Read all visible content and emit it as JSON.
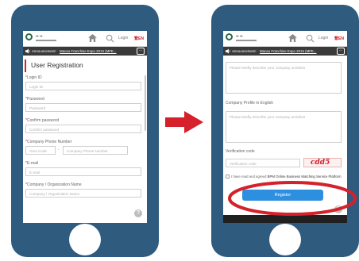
{
  "header": {
    "login_label": "Login",
    "lang_label": "繁EN"
  },
  "announcement": {
    "label": "Announcement:",
    "link_text": "Macao Franchise Expo 2016 (MFE...",
    "more_label": "···"
  },
  "left_screen": {
    "title": "User Registration",
    "fields": [
      {
        "label": "Login ID",
        "required": true,
        "placeholder": "Login ID"
      },
      {
        "label": "Password",
        "required": true,
        "placeholder": "Password"
      },
      {
        "label": "Confirm password",
        "required": true,
        "placeholder": "Confirm password"
      },
      {
        "label": "Company Phone Number",
        "required": true,
        "area_placeholder": "Area Code",
        "dash": "-",
        "phone_placeholder": "Company Phone Number"
      },
      {
        "label": "E-mail",
        "required": true,
        "placeholder": "E-mail"
      },
      {
        "label": "Company / Organization Name",
        "required": true,
        "placeholder": "Company / Organization Name"
      }
    ],
    "help_label": "?"
  },
  "right_screen": {
    "profile_placeholder": "Please briefly describe your company activities",
    "profile_en_label": "Company Profile in English",
    "profile_en_placeholder": "Please briefly describe your company activities",
    "verification_label": "Verification code",
    "verification_placeholder": "Verification code",
    "captcha_text": "cdd5",
    "agree_prefix": "I have read and agreed",
    "agree_link": "BPM Online Business Matching Service Platform",
    "register_label": "Register",
    "help_label": "?"
  },
  "colors": {
    "phone": "#2f5b7f",
    "accent_red": "#d4212b",
    "register_blue": "#2d8fe0"
  }
}
